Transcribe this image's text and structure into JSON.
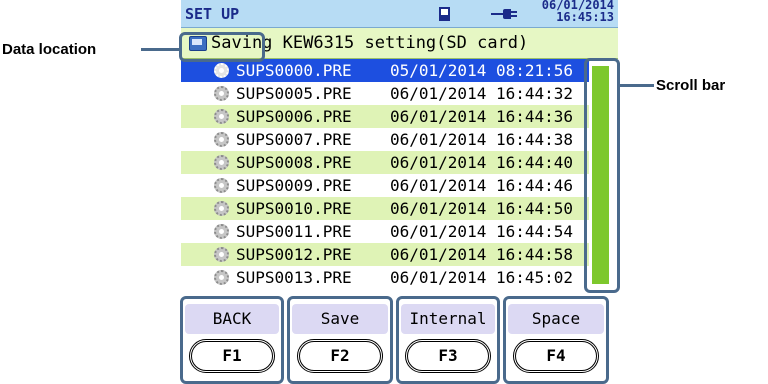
{
  "status": {
    "title": "SET UP",
    "date": "06/01/2014",
    "time": "16:45:13"
  },
  "location": {
    "path": "Saving KEW6315 setting(SD card)"
  },
  "files": [
    {
      "name": "SUPS0000.PRE",
      "datetime": "05/01/2014 08:21:56",
      "selected": true
    },
    {
      "name": "SUPS0005.PRE",
      "datetime": "06/01/2014 16:44:32"
    },
    {
      "name": "SUPS0006.PRE",
      "datetime": "06/01/2014 16:44:36"
    },
    {
      "name": "SUPS0007.PRE",
      "datetime": "06/01/2014 16:44:38"
    },
    {
      "name": "SUPS0008.PRE",
      "datetime": "06/01/2014 16:44:40"
    },
    {
      "name": "SUPS0009.PRE",
      "datetime": "06/01/2014 16:44:46"
    },
    {
      "name": "SUPS0010.PRE",
      "datetime": "06/01/2014 16:44:50"
    },
    {
      "name": "SUPS0011.PRE",
      "datetime": "06/01/2014 16:44:54"
    },
    {
      "name": "SUPS0012.PRE",
      "datetime": "06/01/2014 16:44:58"
    },
    {
      "name": "SUPS0013.PRE",
      "datetime": "06/01/2014 16:45:02"
    }
  ],
  "function_keys": [
    {
      "label": "BACK",
      "key": "F1"
    },
    {
      "label": "Save",
      "key": "F2"
    },
    {
      "label": "Internal",
      "key": "F3"
    },
    {
      "label": "Space",
      "key": "F4"
    }
  ],
  "annotations": {
    "data_location": "Data location",
    "scroll_bar": "Scroll bar"
  },
  "colors": {
    "status_bar": "#b7dcf4",
    "location_bar": "#e6f7c4",
    "row_alt": "#dff3b6",
    "row_selected": "#1d4fe0",
    "scroll_thumb": "#7dc82c",
    "fkey_label": "#dcd9f3",
    "callout": "#4a6a8c"
  },
  "icons": {
    "sd_card": "sd-card-icon",
    "power": "power-plug-icon",
    "folder": "folder-icon",
    "file": "gear-icon"
  }
}
